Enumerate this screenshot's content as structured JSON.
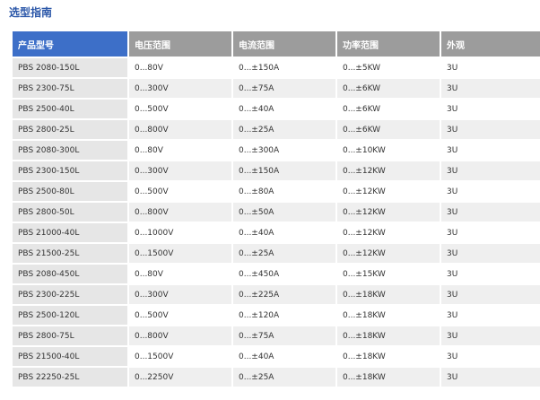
{
  "title": "选型指南",
  "headers": [
    "产品型号",
    "电压范围",
    "电流范围",
    "功率范围",
    "外观"
  ],
  "rows": [
    [
      "PBS 2080-150L",
      "0...80V",
      "0...±150A",
      "0...±5KW",
      "3U"
    ],
    [
      "PBS 2300-75L",
      "0...300V",
      "0...±75A",
      "0...±6KW",
      "3U"
    ],
    [
      "PBS 2500-40L",
      "0...500V",
      "0...±40A",
      "0...±6KW",
      "3U"
    ],
    [
      "PBS 2800-25L",
      "0...800V",
      "0...±25A",
      "0...±6KW",
      "3U"
    ],
    [
      "PBS 2080-300L",
      "0...80V",
      "0...±300A",
      "0...±10KW",
      "3U"
    ],
    [
      "PBS 2300-150L",
      "0...300V",
      "0...±150A",
      "0...±12KW",
      "3U"
    ],
    [
      "PBS 2500-80L",
      "0...500V",
      "0...±80A",
      "0...±12KW",
      "3U"
    ],
    [
      "PBS 2800-50L",
      "0...800V",
      "0...±50A",
      "0...±12KW",
      "3U"
    ],
    [
      "PBS 21000-40L",
      "0...1000V",
      "0...±40A",
      "0...±12KW",
      "3U"
    ],
    [
      "PBS 21500-25L",
      "0...1500V",
      "0...±25A",
      "0...±12KW",
      "3U"
    ],
    [
      "PBS 2080-450L",
      "0...80V",
      "0...±450A",
      "0...±15KW",
      "3U"
    ],
    [
      "PBS 2300-225L",
      "0...300V",
      "0...±225A",
      "0...±18KW",
      "3U"
    ],
    [
      "PBS 2500-120L",
      "0...500V",
      "0...±120A",
      "0...±18KW",
      "3U"
    ],
    [
      "PBS 2800-75L",
      "0...800V",
      "0...±75A",
      "0...±18KW",
      "3U"
    ],
    [
      "PBS 21500-40L",
      "0...1500V",
      "0...±40A",
      "0...±18KW",
      "3U"
    ],
    [
      "PBS 22250-25L",
      "0...2250V",
      "0...±25A",
      "0...±18KW",
      "3U"
    ]
  ],
  "colors": {
    "title": "#2a56a8",
    "header_model": "#3d6fc8",
    "header_other": "#9c9c9c",
    "model_cell": "#e6e6e6",
    "row_shade": "#efefef"
  }
}
